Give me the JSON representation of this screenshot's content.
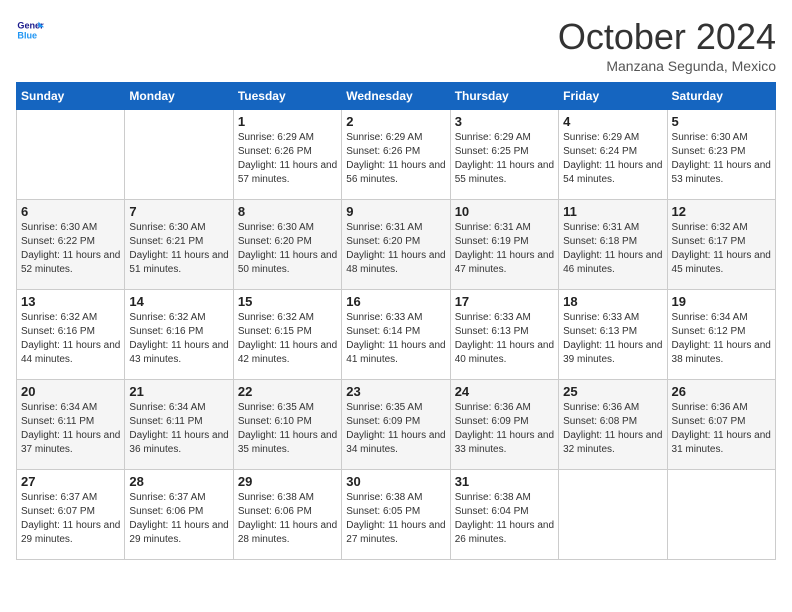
{
  "header": {
    "logo_line1": "General",
    "logo_line2": "Blue",
    "month_title": "October 2024",
    "subtitle": "Manzana Segunda, Mexico"
  },
  "weekdays": [
    "Sunday",
    "Monday",
    "Tuesday",
    "Wednesday",
    "Thursday",
    "Friday",
    "Saturday"
  ],
  "weeks": [
    [
      {
        "day": "",
        "sunrise": "",
        "sunset": "",
        "daylight": ""
      },
      {
        "day": "",
        "sunrise": "",
        "sunset": "",
        "daylight": ""
      },
      {
        "day": "1",
        "sunrise": "Sunrise: 6:29 AM",
        "sunset": "Sunset: 6:26 PM",
        "daylight": "Daylight: 11 hours and 57 minutes."
      },
      {
        "day": "2",
        "sunrise": "Sunrise: 6:29 AM",
        "sunset": "Sunset: 6:26 PM",
        "daylight": "Daylight: 11 hours and 56 minutes."
      },
      {
        "day": "3",
        "sunrise": "Sunrise: 6:29 AM",
        "sunset": "Sunset: 6:25 PM",
        "daylight": "Daylight: 11 hours and 55 minutes."
      },
      {
        "day": "4",
        "sunrise": "Sunrise: 6:29 AM",
        "sunset": "Sunset: 6:24 PM",
        "daylight": "Daylight: 11 hours and 54 minutes."
      },
      {
        "day": "5",
        "sunrise": "Sunrise: 6:30 AM",
        "sunset": "Sunset: 6:23 PM",
        "daylight": "Daylight: 11 hours and 53 minutes."
      }
    ],
    [
      {
        "day": "6",
        "sunrise": "Sunrise: 6:30 AM",
        "sunset": "Sunset: 6:22 PM",
        "daylight": "Daylight: 11 hours and 52 minutes."
      },
      {
        "day": "7",
        "sunrise": "Sunrise: 6:30 AM",
        "sunset": "Sunset: 6:21 PM",
        "daylight": "Daylight: 11 hours and 51 minutes."
      },
      {
        "day": "8",
        "sunrise": "Sunrise: 6:30 AM",
        "sunset": "Sunset: 6:20 PM",
        "daylight": "Daylight: 11 hours and 50 minutes."
      },
      {
        "day": "9",
        "sunrise": "Sunrise: 6:31 AM",
        "sunset": "Sunset: 6:20 PM",
        "daylight": "Daylight: 11 hours and 48 minutes."
      },
      {
        "day": "10",
        "sunrise": "Sunrise: 6:31 AM",
        "sunset": "Sunset: 6:19 PM",
        "daylight": "Daylight: 11 hours and 47 minutes."
      },
      {
        "day": "11",
        "sunrise": "Sunrise: 6:31 AM",
        "sunset": "Sunset: 6:18 PM",
        "daylight": "Daylight: 11 hours and 46 minutes."
      },
      {
        "day": "12",
        "sunrise": "Sunrise: 6:32 AM",
        "sunset": "Sunset: 6:17 PM",
        "daylight": "Daylight: 11 hours and 45 minutes."
      }
    ],
    [
      {
        "day": "13",
        "sunrise": "Sunrise: 6:32 AM",
        "sunset": "Sunset: 6:16 PM",
        "daylight": "Daylight: 11 hours and 44 minutes."
      },
      {
        "day": "14",
        "sunrise": "Sunrise: 6:32 AM",
        "sunset": "Sunset: 6:16 PM",
        "daylight": "Daylight: 11 hours and 43 minutes."
      },
      {
        "day": "15",
        "sunrise": "Sunrise: 6:32 AM",
        "sunset": "Sunset: 6:15 PM",
        "daylight": "Daylight: 11 hours and 42 minutes."
      },
      {
        "day": "16",
        "sunrise": "Sunrise: 6:33 AM",
        "sunset": "Sunset: 6:14 PM",
        "daylight": "Daylight: 11 hours and 41 minutes."
      },
      {
        "day": "17",
        "sunrise": "Sunrise: 6:33 AM",
        "sunset": "Sunset: 6:13 PM",
        "daylight": "Daylight: 11 hours and 40 minutes."
      },
      {
        "day": "18",
        "sunrise": "Sunrise: 6:33 AM",
        "sunset": "Sunset: 6:13 PM",
        "daylight": "Daylight: 11 hours and 39 minutes."
      },
      {
        "day": "19",
        "sunrise": "Sunrise: 6:34 AM",
        "sunset": "Sunset: 6:12 PM",
        "daylight": "Daylight: 11 hours and 38 minutes."
      }
    ],
    [
      {
        "day": "20",
        "sunrise": "Sunrise: 6:34 AM",
        "sunset": "Sunset: 6:11 PM",
        "daylight": "Daylight: 11 hours and 37 minutes."
      },
      {
        "day": "21",
        "sunrise": "Sunrise: 6:34 AM",
        "sunset": "Sunset: 6:11 PM",
        "daylight": "Daylight: 11 hours and 36 minutes."
      },
      {
        "day": "22",
        "sunrise": "Sunrise: 6:35 AM",
        "sunset": "Sunset: 6:10 PM",
        "daylight": "Daylight: 11 hours and 35 minutes."
      },
      {
        "day": "23",
        "sunrise": "Sunrise: 6:35 AM",
        "sunset": "Sunset: 6:09 PM",
        "daylight": "Daylight: 11 hours and 34 minutes."
      },
      {
        "day": "24",
        "sunrise": "Sunrise: 6:36 AM",
        "sunset": "Sunset: 6:09 PM",
        "daylight": "Daylight: 11 hours and 33 minutes."
      },
      {
        "day": "25",
        "sunrise": "Sunrise: 6:36 AM",
        "sunset": "Sunset: 6:08 PM",
        "daylight": "Daylight: 11 hours and 32 minutes."
      },
      {
        "day": "26",
        "sunrise": "Sunrise: 6:36 AM",
        "sunset": "Sunset: 6:07 PM",
        "daylight": "Daylight: 11 hours and 31 minutes."
      }
    ],
    [
      {
        "day": "27",
        "sunrise": "Sunrise: 6:37 AM",
        "sunset": "Sunset: 6:07 PM",
        "daylight": "Daylight: 11 hours and 29 minutes."
      },
      {
        "day": "28",
        "sunrise": "Sunrise: 6:37 AM",
        "sunset": "Sunset: 6:06 PM",
        "daylight": "Daylight: 11 hours and 29 minutes."
      },
      {
        "day": "29",
        "sunrise": "Sunrise: 6:38 AM",
        "sunset": "Sunset: 6:06 PM",
        "daylight": "Daylight: 11 hours and 28 minutes."
      },
      {
        "day": "30",
        "sunrise": "Sunrise: 6:38 AM",
        "sunset": "Sunset: 6:05 PM",
        "daylight": "Daylight: 11 hours and 27 minutes."
      },
      {
        "day": "31",
        "sunrise": "Sunrise: 6:38 AM",
        "sunset": "Sunset: 6:04 PM",
        "daylight": "Daylight: 11 hours and 26 minutes."
      },
      {
        "day": "",
        "sunrise": "",
        "sunset": "",
        "daylight": ""
      },
      {
        "day": "",
        "sunrise": "",
        "sunset": "",
        "daylight": ""
      }
    ]
  ]
}
